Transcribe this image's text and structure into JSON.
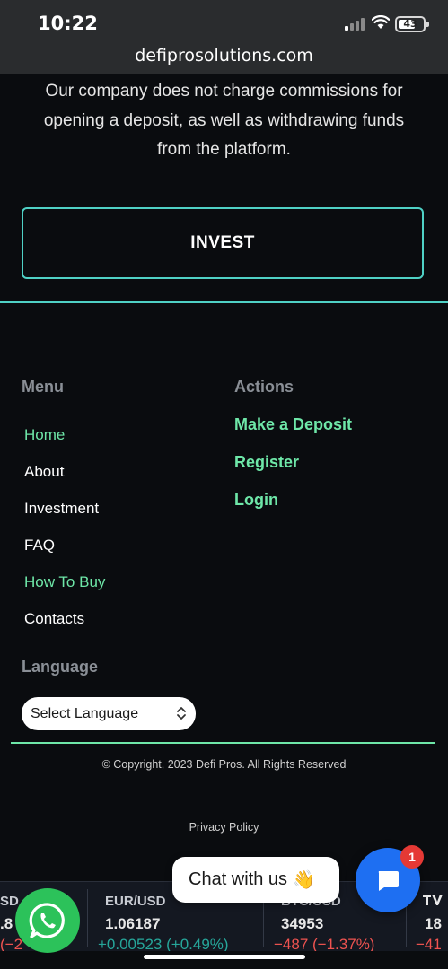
{
  "status_bar": {
    "time": "10:22",
    "battery": "43"
  },
  "browser": {
    "url": "defiprosolutions.com"
  },
  "intro": {
    "text": "Our company does not charge commissions for opening a deposit, as well as withdrawing funds from the platform."
  },
  "invest_button": {
    "label": "INVEST"
  },
  "footer": {
    "menu_heading": "Menu",
    "menu_items": [
      "Home",
      "About",
      "Investment",
      "FAQ",
      "How To Buy",
      "Contacts"
    ],
    "actions_heading": "Actions",
    "action_items": [
      "Make a Deposit",
      "Register",
      "Login"
    ],
    "language_heading": "Language",
    "language_select": "Select Language",
    "copyright": "© Copyright, 2023 Defi Pros. All Rights Reserved",
    "privacy": "Privacy Policy"
  },
  "ticker": {
    "items": [
      {
        "symbol": "SD",
        "price": ".8",
        "change": "(−2"
      },
      {
        "symbol": "EUR/USD",
        "price": "1.06187",
        "change": "+0.00523 (+0.49%)"
      },
      {
        "symbol": "BTC/USD",
        "price": "34953",
        "change": "−487 (−1.37%)"
      },
      {
        "symbol": "",
        "price": "18",
        "change": "−41"
      }
    ]
  },
  "chat": {
    "label": "Chat with us",
    "wave": "👋",
    "badge": "1"
  },
  "colors": {
    "accent": "#4fd1c5",
    "green": "#6ee7a8",
    "chat_blue": "#1e6ff2",
    "whatsapp": "#2cc25a"
  }
}
